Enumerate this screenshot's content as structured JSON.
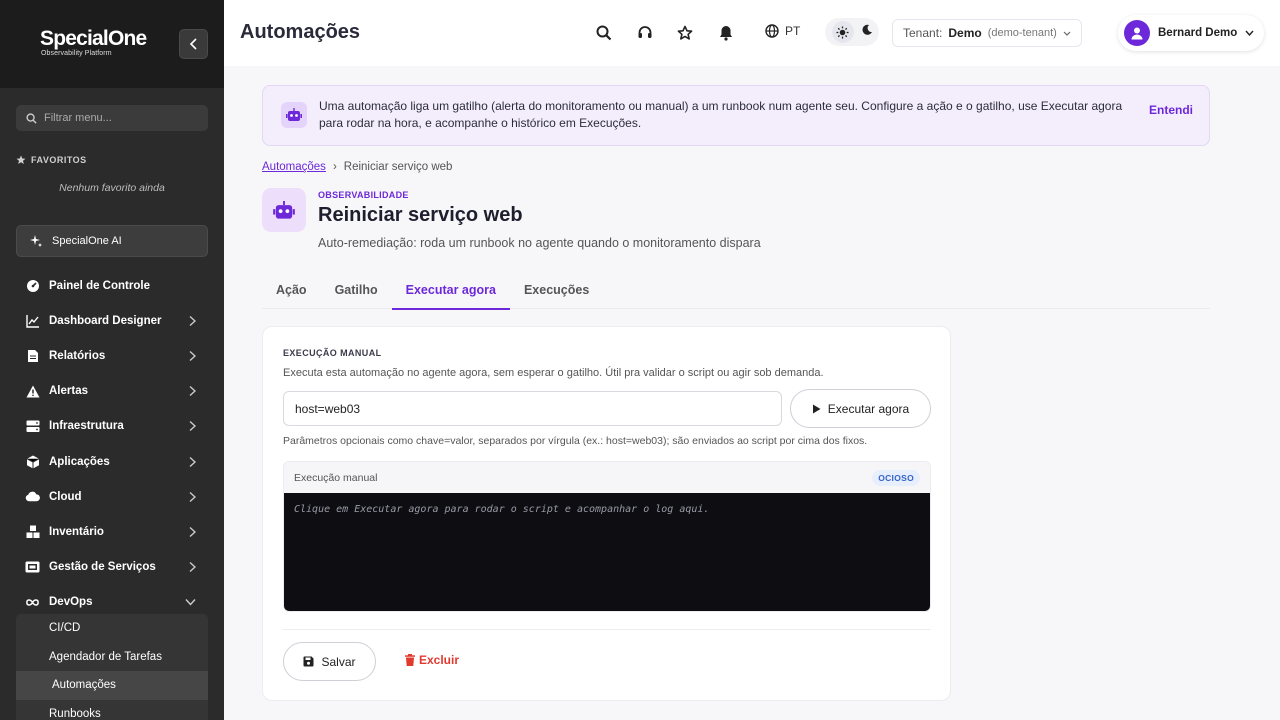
{
  "sidebar": {
    "logo_name": "SpecialOne",
    "logo_tag": "Observability Platform",
    "search_placeholder": "Filtrar menu...",
    "favorites_title": "FAVORITOS",
    "favorites_empty": "Nenhum favorito ainda",
    "ai_label": "SpecialOne AI",
    "items": [
      {
        "label": "Painel de Controle",
        "icon": "gauge-icon"
      },
      {
        "label": "Dashboard Designer",
        "icon": "chart-line-icon"
      },
      {
        "label": "Relatórios",
        "icon": "file-icon"
      },
      {
        "label": "Alertas",
        "icon": "warning-icon"
      },
      {
        "label": "Infraestrutura",
        "icon": "server-icon"
      },
      {
        "label": "Aplicações",
        "icon": "cube-icon"
      },
      {
        "label": "Cloud",
        "icon": "cloud-icon"
      },
      {
        "label": "Inventário",
        "icon": "boxes-icon"
      },
      {
        "label": "Gestão de Serviços",
        "icon": "ticket-icon"
      },
      {
        "label": "DevOps",
        "icon": "infinity-icon"
      }
    ],
    "devops_children": [
      "CI/CD",
      "Agendador de Tarefas",
      "Automações",
      "Runbooks"
    ]
  },
  "header": {
    "title": "Automações",
    "lang": "PT",
    "tenant_label": "Tenant:",
    "tenant_name": "Demo",
    "tenant_id": "(demo-tenant)",
    "user_name": "Bernard Demo"
  },
  "banner": {
    "text": "Uma automação liga um gatilho (alerta do monitoramento ou manual) a um runbook num agente seu. Configure a ação e o gatilho, use Executar agora para rodar na hora, e acompanhe o histórico em Execuções.",
    "dismiss": "Entendi"
  },
  "breadcrumb": {
    "root": "Automações",
    "sep": "›",
    "current": "Reiniciar serviço web"
  },
  "automation": {
    "category": "OBSERVABILIDADE",
    "title": "Reiniciar serviço web",
    "description": "Auto-remediação: roda um runbook no agente quando o monitoramento dispara"
  },
  "tabs": [
    "Ação",
    "Gatilho",
    "Executar agora",
    "Execuções"
  ],
  "manual": {
    "title": "EXECUÇÃO MANUAL",
    "description": "Executa esta automação no agente agora, sem esperar o gatilho. Útil pra validar o script ou agir sob demanda.",
    "param_value": "host=web03",
    "run_label": "Executar agora",
    "hint": "Parâmetros opcionais como chave=valor, separados por vírgula (ex.: host=web03); são enviados ao script por cima dos fixos.",
    "console_title": "Execução manual",
    "status": "OCIOSO",
    "console_placeholder": "Clique em Executar agora para rodar o script e acompanhar o log aqui.",
    "save_label": "Salvar",
    "delete_label": "Excluir"
  },
  "colors": {
    "accent": "#6d28d9",
    "danger": "#e03a2f",
    "sidebar_bg": "#2b2b2b",
    "status_badge": "#3563c9"
  }
}
